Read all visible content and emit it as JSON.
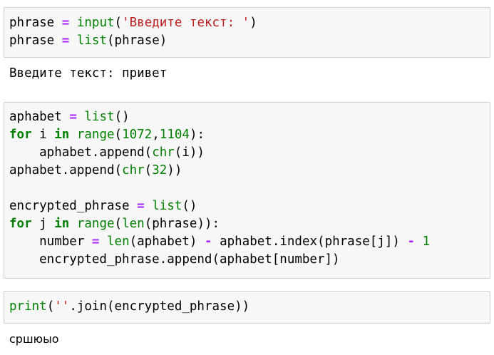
{
  "cells": [
    {
      "lines": [
        [
          [
            "phrase",
            ""
          ],
          [
            " ",
            ""
          ],
          [
            "=",
            "op"
          ],
          [
            " ",
            ""
          ],
          [
            "input",
            "bi"
          ],
          [
            "(",
            ""
          ],
          [
            "'Введите текст: '",
            "str"
          ],
          [
            ")",
            ""
          ]
        ],
        [
          [
            "phrase",
            ""
          ],
          [
            " ",
            ""
          ],
          [
            "=",
            "op"
          ],
          [
            " ",
            ""
          ],
          [
            "list",
            "bi"
          ],
          [
            "(phrase)",
            ""
          ]
        ]
      ],
      "output": "Введите текст: привет"
    },
    {
      "lines": [
        [
          [
            "aphabet",
            ""
          ],
          [
            " ",
            ""
          ],
          [
            "=",
            "op"
          ],
          [
            " ",
            ""
          ],
          [
            "list",
            "bi"
          ],
          [
            "()",
            ""
          ]
        ],
        [
          [
            "for",
            "kw"
          ],
          [
            " i ",
            ""
          ],
          [
            "in",
            "kw"
          ],
          [
            " ",
            ""
          ],
          [
            "range",
            "bi"
          ],
          [
            "(",
            ""
          ],
          [
            "1072",
            "num"
          ],
          [
            ",",
            ""
          ],
          [
            "1104",
            "num"
          ],
          [
            "):",
            ""
          ]
        ],
        [
          [
            "    aphabet.append(",
            ""
          ],
          [
            "chr",
            "bi"
          ],
          [
            "(i))",
            ""
          ]
        ],
        [
          [
            "aphabet.append(",
            ""
          ],
          [
            "chr",
            "bi"
          ],
          [
            "(",
            ""
          ],
          [
            "32",
            "num"
          ],
          [
            "))",
            ""
          ]
        ],
        [],
        [
          [
            "encrypted_phrase",
            ""
          ],
          [
            " ",
            ""
          ],
          [
            "=",
            "op"
          ],
          [
            " ",
            ""
          ],
          [
            "list",
            "bi"
          ],
          [
            "()",
            ""
          ]
        ],
        [
          [
            "for",
            "kw"
          ],
          [
            " j ",
            ""
          ],
          [
            "in",
            "kw"
          ],
          [
            " ",
            ""
          ],
          [
            "range",
            "bi"
          ],
          [
            "(",
            ""
          ],
          [
            "len",
            "bi"
          ],
          [
            "(phrase)):",
            ""
          ]
        ],
        [
          [
            "    number",
            ""
          ],
          [
            " ",
            ""
          ],
          [
            "=",
            "op"
          ],
          [
            " ",
            ""
          ],
          [
            "len",
            "bi"
          ],
          [
            "(aphabet)",
            ""
          ],
          [
            " ",
            ""
          ],
          [
            "-",
            "op"
          ],
          [
            " aphabet.index(phrase[j])",
            ""
          ],
          [
            " ",
            ""
          ],
          [
            "-",
            "op"
          ],
          [
            " ",
            ""
          ],
          [
            "1",
            "num"
          ]
        ],
        [
          [
            "    encrypted_phrase.append(aphabet[number])",
            ""
          ]
        ]
      ],
      "output": ""
    },
    {
      "lines": [
        [
          [
            "print",
            "bi"
          ],
          [
            "(",
            ""
          ],
          [
            "''",
            "str"
          ],
          [
            ".join(encrypted_phrase))",
            ""
          ]
        ]
      ],
      "output": "сршюыо"
    }
  ]
}
